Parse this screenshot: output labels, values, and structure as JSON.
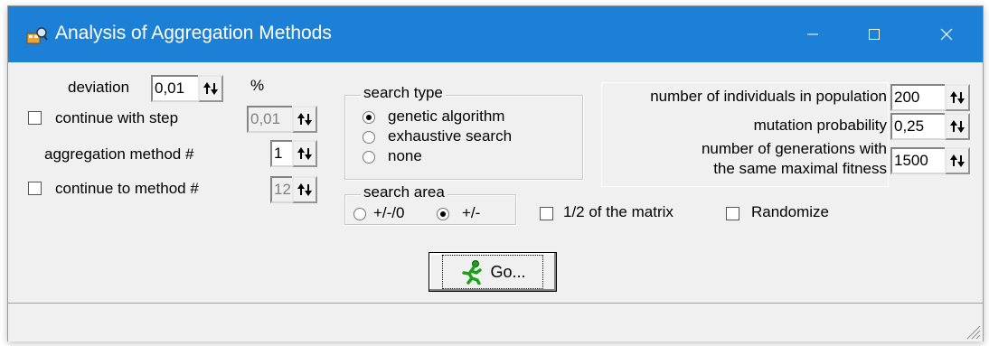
{
  "window": {
    "title": "Analysis of Aggregation Methods",
    "titlebar_color": "#1c80d6",
    "icons": {
      "app": "analysis-app-icon",
      "minimize": "minimize-icon",
      "maximize": "maximize-icon",
      "close": "close-icon"
    }
  },
  "left": {
    "deviation_label": "deviation",
    "deviation_value": "0,01",
    "percent_label": "%",
    "continue_step_label": "continue with step",
    "continue_step_checked": false,
    "step_value": "0,01",
    "aggregation_method_label": "aggregation method #",
    "aggregation_method_value": "1",
    "continue_method_label": "continue to method #",
    "continue_method_checked": false,
    "continue_method_value": "12"
  },
  "search_type": {
    "title": "search type",
    "options": [
      "genetic algorithm",
      "exhaustive search",
      "none"
    ],
    "selected": "genetic algorithm"
  },
  "search_area": {
    "title": "search area",
    "options": [
      "+/-/0",
      "+/-"
    ],
    "selected": "+/-"
  },
  "options": {
    "half_matrix_label": "1/2 of the matrix",
    "half_matrix_checked": false,
    "randomize_label": "Randomize",
    "randomize_checked": false
  },
  "genetic": {
    "population_label": "number of individuals in population",
    "population_value": "200",
    "mutation_label": "mutation probability",
    "mutation_value": "0,25",
    "generations_label_1": "number of generations with",
    "generations_label_2": "the same maximal fitness",
    "generations_value": "1500"
  },
  "go_button": {
    "label": "Go...",
    "icon": "running-man-icon"
  }
}
